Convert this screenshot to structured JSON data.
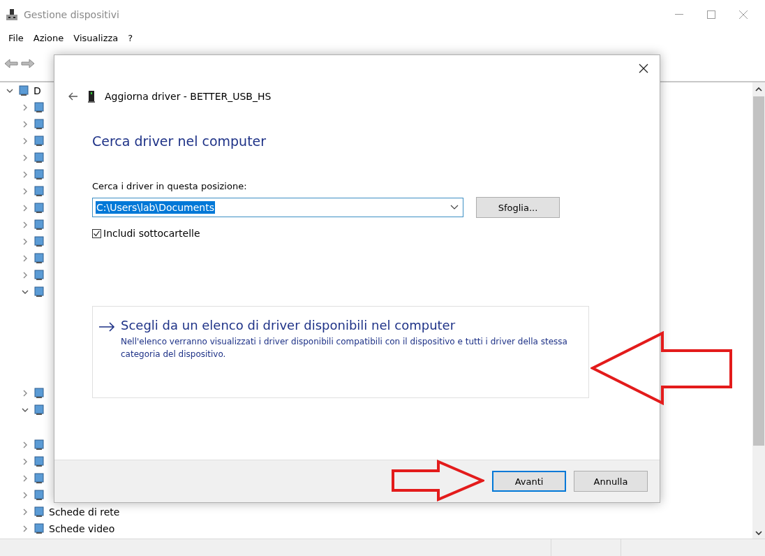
{
  "window": {
    "title": "Gestione dispositivi"
  },
  "menu": [
    "File",
    "Azione",
    "Visualizza",
    "?"
  ],
  "tree": {
    "label": "D",
    "expanded": true,
    "children": [
      {
        "expanded": false
      },
      {
        "expanded": false
      },
      {
        "expanded": false
      },
      {
        "expanded": false
      },
      {
        "expanded": false
      },
      {
        "expanded": false
      },
      {
        "expanded": false
      },
      {
        "expanded": false
      },
      {
        "expanded": false
      },
      {
        "expanded": false
      },
      {
        "expanded": false
      },
      {
        "expanded": true
      },
      {
        "expanded": false
      },
      {
        "expanded": true
      },
      {
        "expanded": false
      },
      {
        "expanded": false
      },
      {
        "expanded": false
      },
      {
        "expanded": false
      },
      {
        "expanded": false,
        "label": "Schede di rete"
      },
      {
        "expanded": false,
        "label": "Schede video"
      }
    ]
  },
  "dialog": {
    "title": "Aggiorna driver - BETTER_USB_HS",
    "heading": "Cerca driver nel computer",
    "path_label": "Cerca i driver in questa posizione:",
    "path_value": "C:\\Users\\lab\\Documents",
    "path_text_selected": true,
    "browse_button": "Sfoglia...",
    "include_subfolders": {
      "label": "Includi sottocartelle",
      "checked": true
    },
    "option": {
      "title": "Scegli da un elenco di driver disponibili nel computer",
      "description": "Nell'elenco verranno visualizzati i driver disponibili compatibili con il dispositivo e tutti i driver della stessa categoria del dispositivo."
    },
    "buttons": [
      {
        "label": "Avanti",
        "default": true
      },
      {
        "label": "Annulla",
        "default": false
      }
    ]
  }
}
